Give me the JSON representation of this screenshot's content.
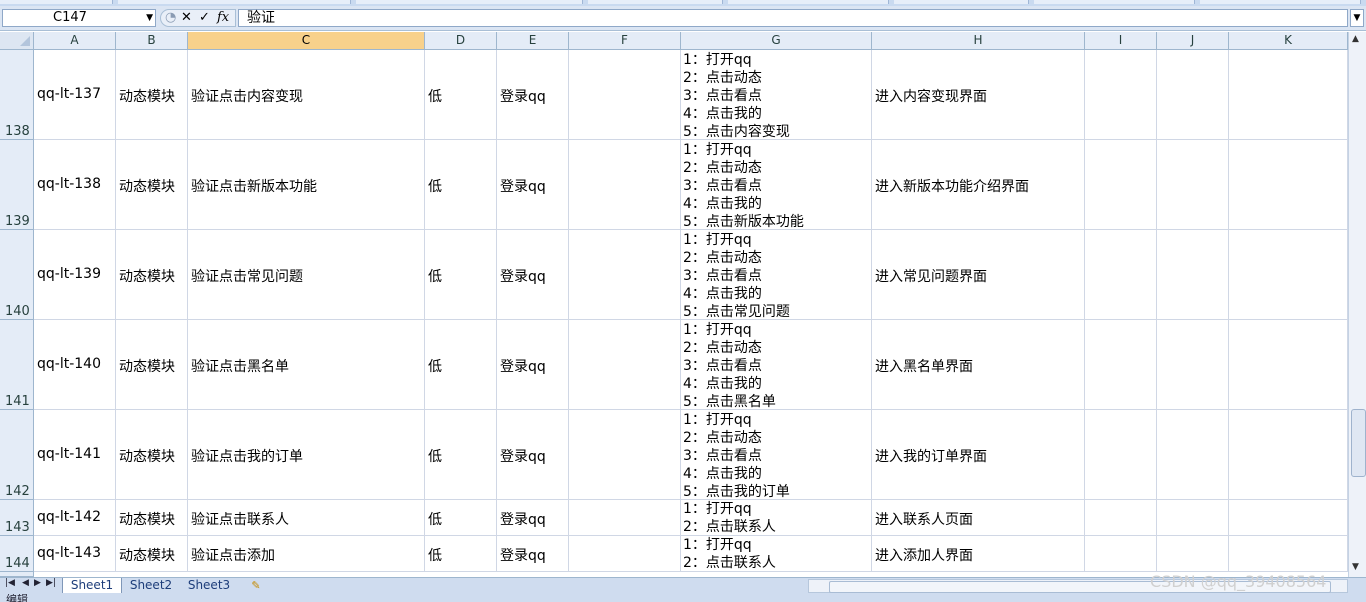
{
  "formula_bar": {
    "name_box": "C147",
    "cancel_glyph": "✕",
    "enter_glyph": "✓",
    "fx_label": "fx",
    "content": "验证"
  },
  "columns": [
    "A",
    "B",
    "C",
    "D",
    "E",
    "F",
    "G",
    "H",
    "I",
    "J",
    "K"
  ],
  "selected_column": "C",
  "rows": [
    {
      "num": "138",
      "id": "qq-lt-137",
      "module": "动态模块",
      "title": "验证点击内容变现",
      "priority": "低",
      "precondition": "登录qq",
      "f": "",
      "steps": [
        "1：打开qq",
        "2：点击动态",
        "3：点击看点",
        "4：点击我的",
        "5：点击内容变现"
      ],
      "expected": "进入内容变现界面"
    },
    {
      "num": "139",
      "id": "qq-lt-138",
      "module": "动态模块",
      "title": "验证点击新版本功能",
      "priority": "低",
      "precondition": "登录qq",
      "f": "",
      "steps": [
        "1：打开qq",
        "2：点击动态",
        "3：点击看点",
        "4：点击我的",
        "5：点击新版本功能"
      ],
      "expected": "进入新版本功能介绍界面"
    },
    {
      "num": "140",
      "id": "qq-lt-139",
      "module": "动态模块",
      "title": "验证点击常见问题",
      "priority": "低",
      "precondition": "登录qq",
      "f": "",
      "steps": [
        "1：打开qq",
        "2：点击动态",
        "3：点击看点",
        "4：点击我的",
        "5：点击常见问题"
      ],
      "expected": "进入常见问题界面"
    },
    {
      "num": "141",
      "id": "qq-lt-140",
      "module": "动态模块",
      "title": "验证点击黑名单",
      "priority": "低",
      "precondition": "登录qq",
      "f": "",
      "steps": [
        "1：打开qq",
        "2：点击动态",
        "3：点击看点",
        "4：点击我的",
        "5：点击黑名单"
      ],
      "expected": "进入黑名单界面"
    },
    {
      "num": "142",
      "id": "qq-lt-141",
      "module": "动态模块",
      "title": "验证点击我的订单",
      "priority": "低",
      "precondition": "登录qq",
      "f": "",
      "steps": [
        "1：打开qq",
        "2：点击动态",
        "3：点击看点",
        "4：点击我的",
        "5：点击我的订单"
      ],
      "expected": "进入我的订单界面"
    },
    {
      "num": "143",
      "id": "qq-lt-142",
      "module": "动态模块",
      "title": "验证点击联系人",
      "priority": "低",
      "precondition": "登录qq",
      "f": "",
      "steps": [
        "1：打开qq",
        "2：点击联系人"
      ],
      "expected": "进入联系人页面"
    },
    {
      "num": "144",
      "id": "qq-lt-143",
      "module": "动态模块",
      "title": "验证点击添加",
      "priority": "低",
      "precondition": "登录qq",
      "f": "",
      "steps": [
        "1：打开qq",
        "2：点击联系人"
      ],
      "expected": "进入添加人界面"
    }
  ],
  "sheet_tabs": [
    "Sheet1",
    "Sheet2",
    "Sheet3"
  ],
  "active_sheet": "Sheet1",
  "status_bar": {
    "mode": "编辑"
  },
  "watermark": "CSDN @qq_39408564",
  "icons": [
    "dropdown-arrow-icon",
    "cancel-icon",
    "enter-check-icon",
    "function-icon",
    "expand-formula-icon",
    "scroll-up-icon",
    "scroll-down-icon",
    "first-sheet-icon",
    "prev-sheet-icon",
    "next-sheet-icon",
    "last-sheet-icon",
    "insert-sheet-icon"
  ]
}
